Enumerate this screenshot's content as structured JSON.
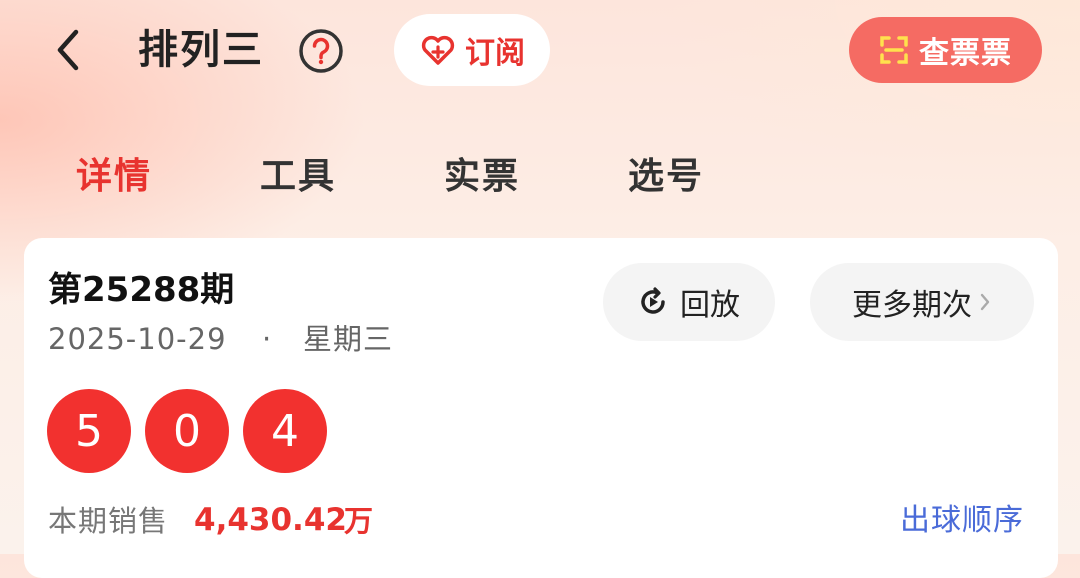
{
  "header": {
    "title": "排列三",
    "subscribe_label": "订阅",
    "check_ticket_label": "查票票"
  },
  "tabs": [
    {
      "label": "详情",
      "active": true
    },
    {
      "label": "工具",
      "active": false
    },
    {
      "label": "实票",
      "active": false
    },
    {
      "label": "选号",
      "active": false
    }
  ],
  "issue": {
    "title": "第25288期",
    "date": "2025-10-29",
    "separator": "·",
    "weekday": "星期三",
    "replay_label": "回放",
    "more_label": "更多期次",
    "balls": [
      "5",
      "0",
      "4"
    ],
    "sales_label": "本期销售",
    "sales_value": "4,430.42",
    "sales_unit": "万",
    "order_link": "出球顺序"
  },
  "colors": {
    "accent_red": "#e8332f",
    "ball_red": "#f2312f",
    "check_ticket_bg": "#f56b63",
    "link_blue": "#4a6bd8"
  },
  "icons": {
    "back": "chevron-left-icon",
    "help": "question-circle-icon",
    "subscribe": "heart-plus-icon",
    "check_ticket": "scan-icon",
    "replay": "replay-icon",
    "more": "chevron-right-icon"
  }
}
